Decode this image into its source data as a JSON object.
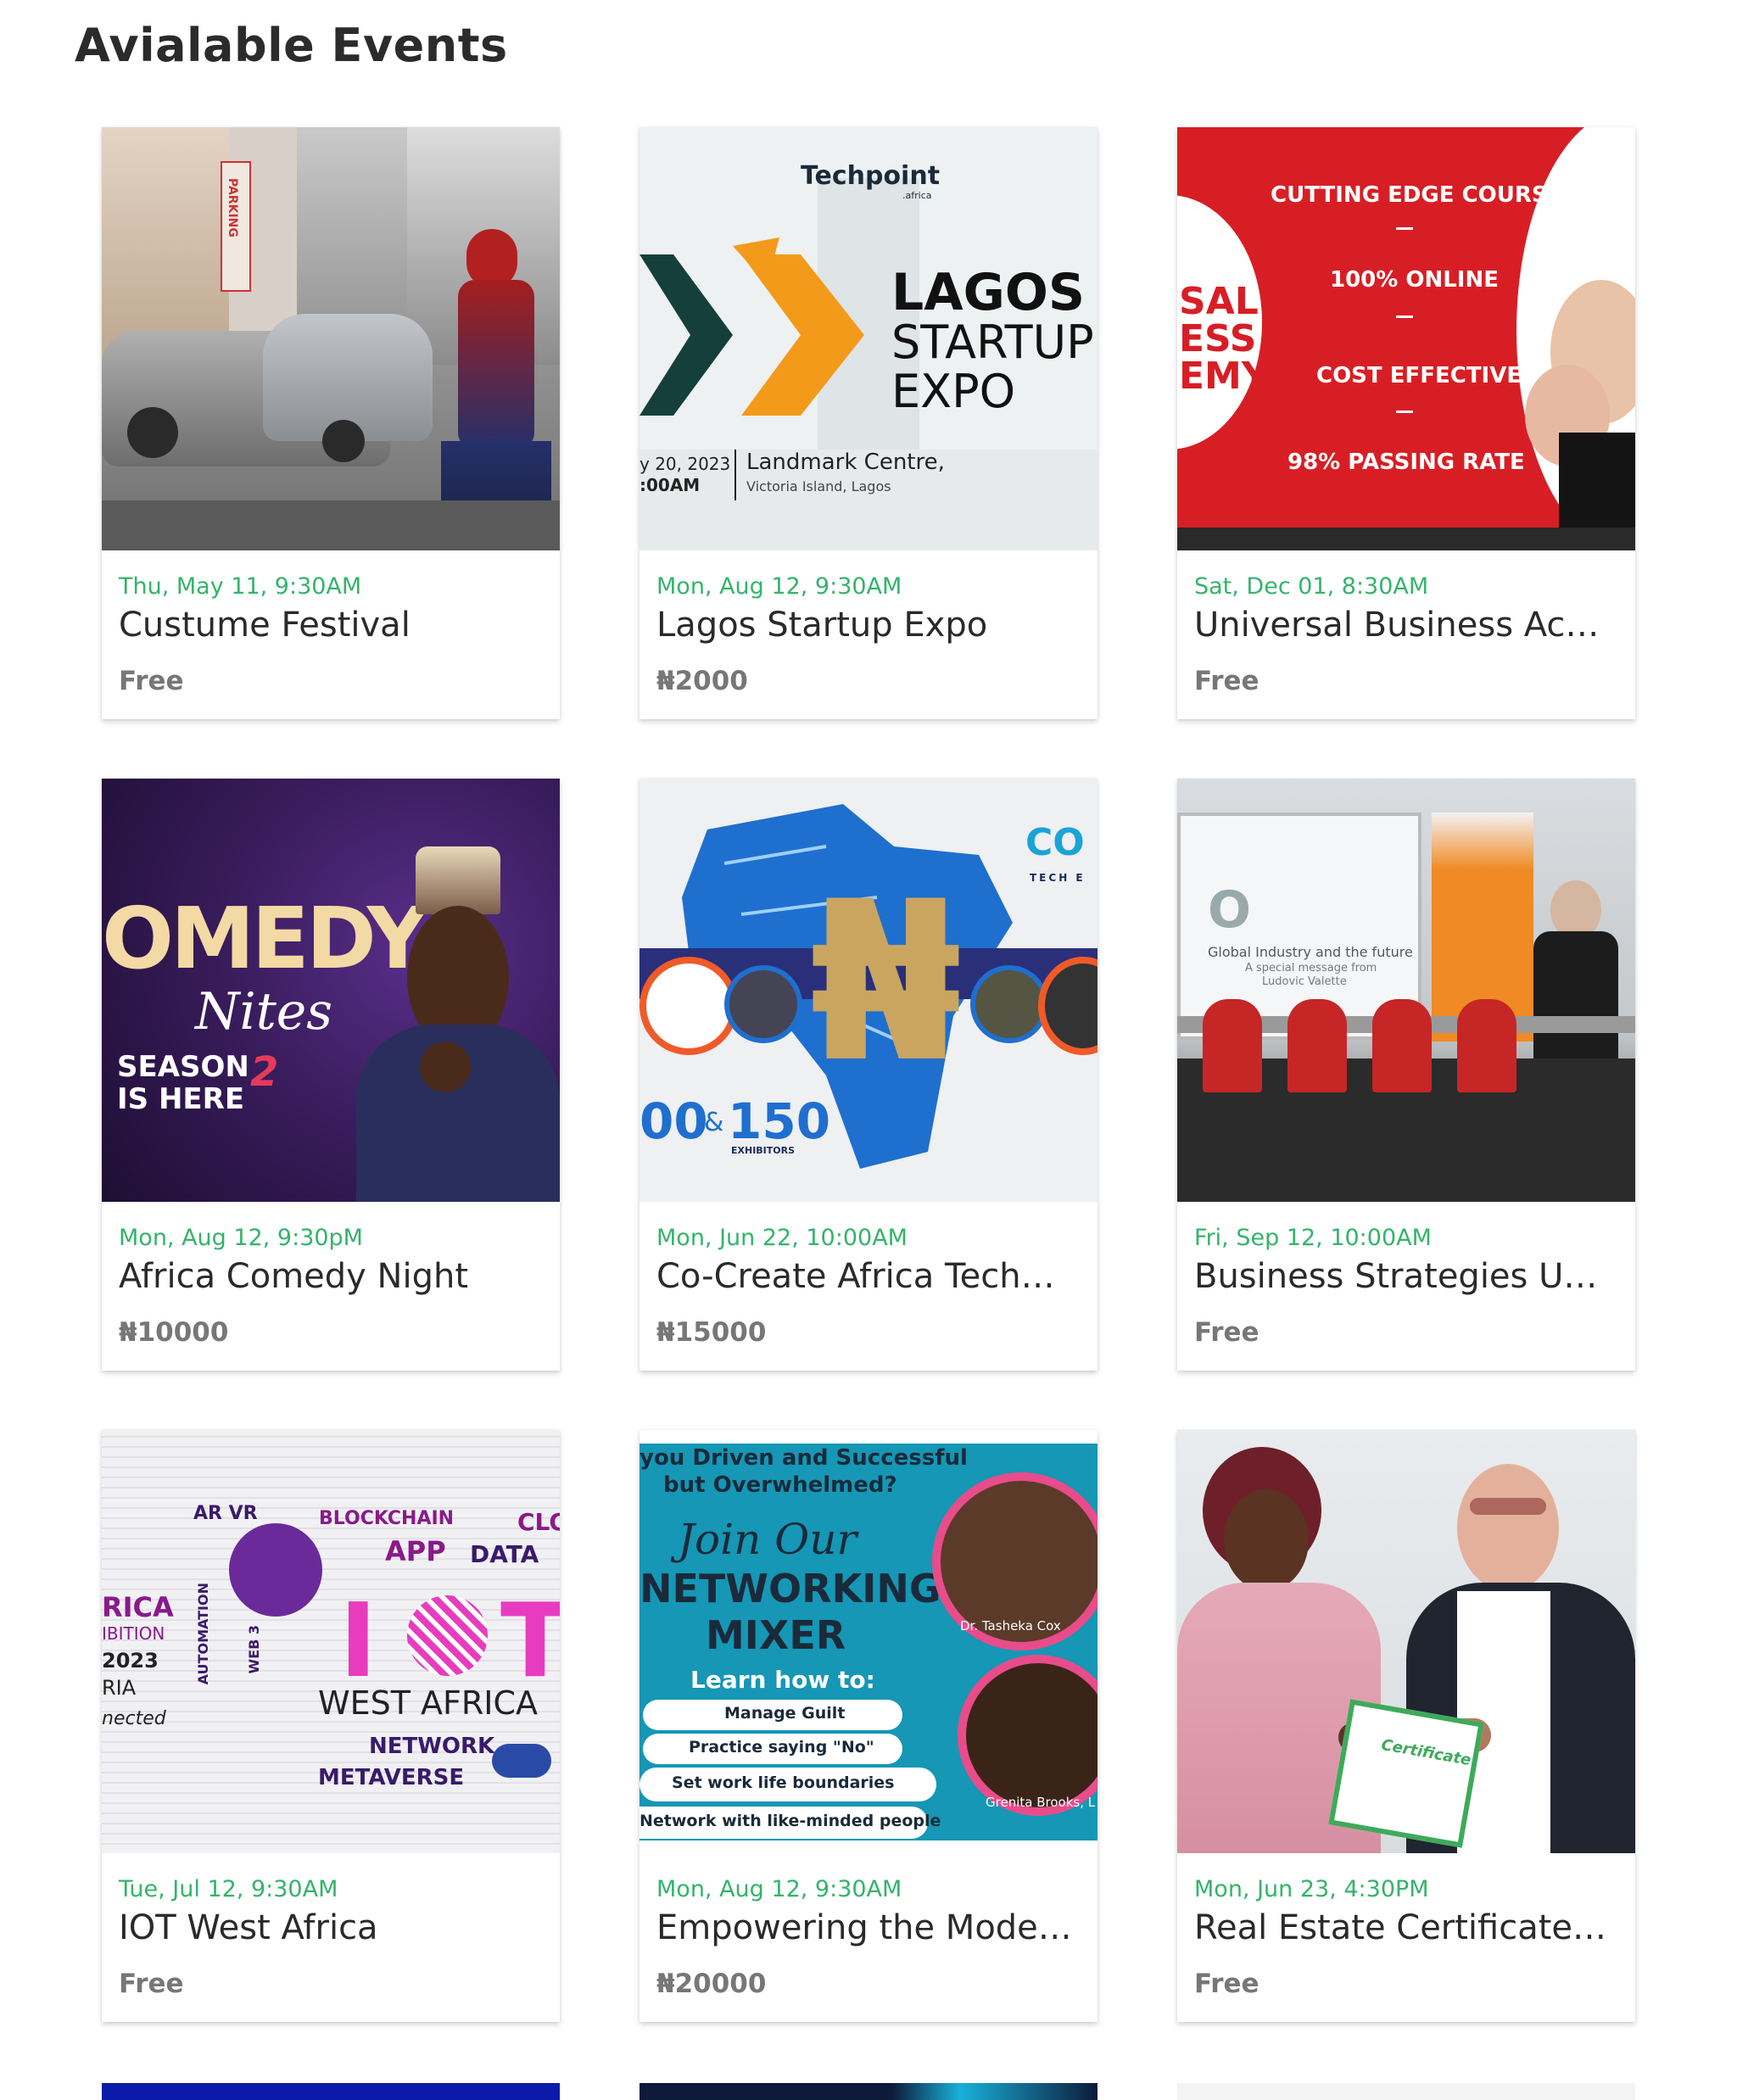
{
  "page": {
    "title": "Avialable Events"
  },
  "events": [
    {
      "date": "Thu, May 11, 9:30AM",
      "title": "Custume Festival",
      "price": "Free",
      "image": {
        "texts": [
          "PARKING"
        ]
      }
    },
    {
      "date": "Mon, Aug 12, 9:30AM",
      "title": "Lagos Startup Expo",
      "price": "₦2000",
      "image": {
        "texts": [
          "Techpoint",
          ".africa",
          "LAGOS",
          "STARTUP",
          "EXPO",
          "y 20, 2023",
          ":00AM",
          "Landmark Centre,",
          "Victoria Island, Lagos"
        ]
      }
    },
    {
      "date": "Sat, Dec 01, 8:30AM",
      "title": "Universal Business Academy",
      "price": "Free",
      "image": {
        "texts": [
          "CUTTING EDGE COURSES",
          "100% ONLINE",
          "COST EFFECTIVE",
          "98% PASSING RATE",
          "SAL",
          "ESS",
          "EMY"
        ]
      }
    },
    {
      "date": "Mon, Aug 12, 9:30pM",
      "title": "Africa Comedy Night",
      "price": "₦10000",
      "image": {
        "texts": [
          "OMEDY",
          "Nites",
          "SEASON",
          "IS HERE",
          "2"
        ]
      }
    },
    {
      "date": "Mon, Jun 22, 10:00AM",
      "title": "Co-Create Africa Tech Summit",
      "price": "₦15000",
      "image": {
        "texts": [
          "CO",
          "TECH E",
          "00",
          "&",
          "150",
          "EXHIBITORS",
          "₦"
        ]
      }
    },
    {
      "date": "Fri, Sep 12, 10:00AM",
      "title": "Business Strategies Update",
      "price": "Free",
      "image": {
        "texts": [
          "Global Industry and the future",
          "A special message from",
          "Ludovic Valette"
        ]
      }
    },
    {
      "date": "Tue, Jul 12, 9:30AM",
      "title": "IOT West Africa",
      "price": "Free",
      "image": {
        "texts": [
          "AR VR",
          "BLOCKCHAIN",
          "CLO",
          "APP",
          "DATA",
          "I",
          "T",
          "WEST AFRICA",
          "NETWORK",
          "METAVERSE",
          "RICA",
          "IBITION",
          "2023",
          "RIA",
          "nected",
          "AUTOMATION",
          "WEB 3"
        ]
      }
    },
    {
      "date": "Mon, Aug 12, 9:30AM",
      "title": "Empowering the Modern Woman",
      "price": "₦20000",
      "image": {
        "texts": [
          "you Driven and Successful",
          "but Overwhelmed?",
          "Join Our",
          "NETWORKING",
          "MIXER",
          "Learn how to:",
          "Manage Guilt",
          "Practice saying \"No\"",
          "Set work life boundaries",
          "Network with like-minded people",
          "Dr. Tasheka Cox",
          "Grenita Brooks, L"
        ]
      }
    },
    {
      "date": "Mon, Jun 23, 4:30PM",
      "title": "Real Estate Certificate Award",
      "price": "Free",
      "image": {
        "texts": [
          "Certificate"
        ]
      }
    }
  ],
  "colors": {
    "date": "#33b46a",
    "title": "#2a2a2a",
    "price": "#777777",
    "heading": "#2b2b2b"
  }
}
